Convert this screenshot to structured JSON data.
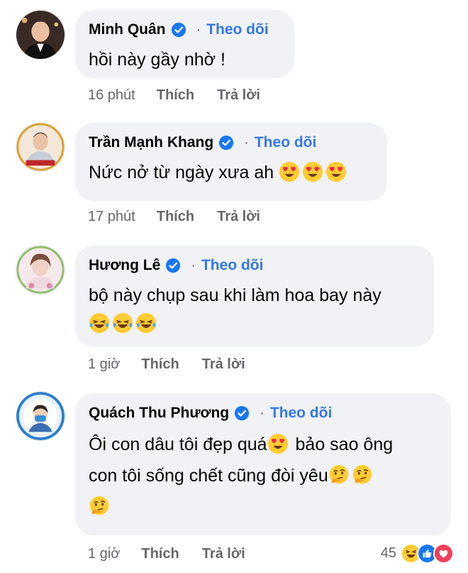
{
  "colors": {
    "bubble": "#f0f2f5",
    "link": "#3578e5",
    "meta": "#65676b",
    "verified": "#1877f2"
  },
  "comments": [
    {
      "name": "Minh Quân",
      "follow": "Theo dõi",
      "text": "hồi này gầy nhờ !",
      "time": "16 phút",
      "like": "Thích",
      "reply": "Trả lời"
    },
    {
      "name": "Trần Mạnh Khang",
      "follow": "Theo dõi",
      "text": "Nức nở từ ngày xưa ah",
      "emojis": [
        "heart-eyes",
        "heart-eyes",
        "heart-eyes"
      ],
      "time": "17 phút",
      "like": "Thích",
      "reply": "Trả lời"
    },
    {
      "name": "Hương Lê",
      "follow": "Theo dõi",
      "text": "bộ này chụp sau khi làm hoa bay này",
      "emojis": [
        "laughing-tears",
        "laughing-tears",
        "laughing-tears"
      ],
      "time": "1 giờ",
      "like": "Thích",
      "reply": "Trả lời"
    },
    {
      "name": "Quách Thu Phương",
      "follow": "Theo dõi",
      "text_a": "Ôi con dâu tôi đẹp quá",
      "text_b": " bảo sao ông",
      "text_c": "con tôi sống chết cũng đòi yêu",
      "emojis": [
        "heart-eyes",
        "thinking",
        "thinking",
        "thinking"
      ],
      "time": "1 giờ",
      "like": "Thích",
      "reply": "Trả lời",
      "reaction_count": "45",
      "reactions": [
        "haha",
        "like",
        "love"
      ]
    }
  ]
}
